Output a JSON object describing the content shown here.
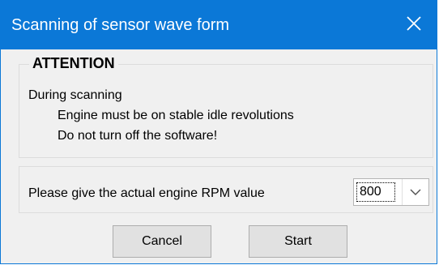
{
  "window": {
    "title": "Scanning of sensor wave form"
  },
  "attention": {
    "title": "ATTENTION",
    "line1": "During scanning",
    "line2": "Engine must be on stable idle revolutions",
    "line3": "Do not turn off the software!"
  },
  "rpm": {
    "label": "Please give the actual engine RPM value",
    "selected": "800"
  },
  "buttons": {
    "cancel": "Cancel",
    "start": "Start"
  },
  "icons": {
    "close": "close-icon",
    "dropdown": "chevron-down-icon"
  },
  "colors": {
    "titlebar": "#0b78d7",
    "background": "#f0f0f0",
    "button": "#e1e1e1"
  }
}
